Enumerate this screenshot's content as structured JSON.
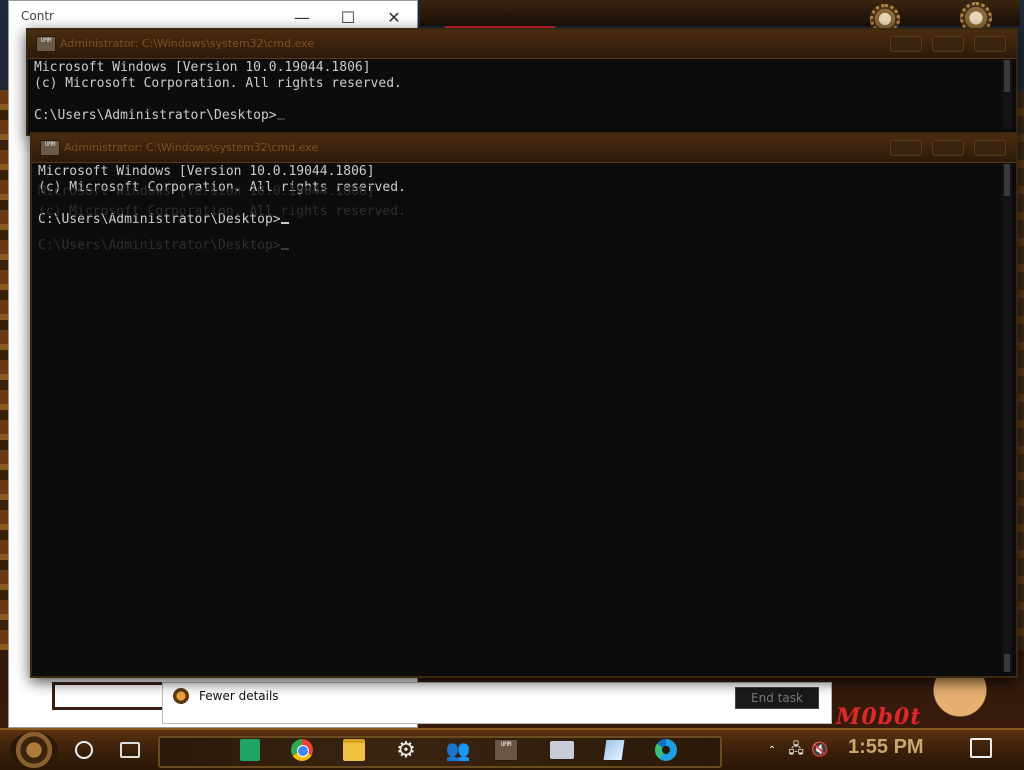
{
  "task_manager": {
    "title": "Contr",
    "minimize_label": "—",
    "maximize_label": "☐",
    "close_label": "✕",
    "fewer_details_label": "Fewer details",
    "end_task_label": "End task"
  },
  "cmd_back": {
    "title": "Administrator: C:\\Windows\\system32\\cmd.exe",
    "icon_text": "UMM",
    "lines": [
      "Microsoft Windows [Version 10.0.19044.1806]",
      "(c) Microsoft Corporation. All rights reserved.",
      "",
      "C:\\Users\\Administrator\\Desktop>"
    ]
  },
  "cmd_front": {
    "title": "Administrator: C:\\Windows\\system32\\cmd.exe",
    "icon_text": "UMM",
    "lines": [
      "Microsoft Windows [Version 10.0.19044.1806]",
      "(c) Microsoft Corporation. All rights reserved.",
      "",
      "C:\\Users\\Administrator\\Desktop>"
    ],
    "ghost_lines": [
      "Microsoft Windows [Version 10.0.19044.1806]",
      "(c) Microsoft Corporation. All rights reserved.",
      "",
      "C:\\Users\\Administrator\\Desktop>"
    ]
  },
  "wallpaper": {
    "brand_text": "M0b0t"
  },
  "taskbar": {
    "apps": [
      {
        "name": "google-sheets",
        "icon": "sheets-icon"
      },
      {
        "name": "chrome",
        "icon": "chrome-icon"
      },
      {
        "name": "file-explorer",
        "icon": "folder-icon"
      },
      {
        "name": "settings",
        "icon": "gear-icon"
      },
      {
        "name": "people",
        "icon": "people-icon"
      },
      {
        "name": "command-prompt",
        "icon": "cmd-icon"
      },
      {
        "name": "powershell",
        "icon": "powershell-icon"
      },
      {
        "name": "paint",
        "icon": "paint-icon"
      },
      {
        "name": "edge",
        "icon": "edge-icon"
      }
    ],
    "cmd_icon_text": "UMM",
    "clock": "1:55 PM",
    "tray_icons": [
      "chevron-up-icon",
      "network-icon",
      "volume-muted-icon",
      "notification-icon"
    ]
  }
}
